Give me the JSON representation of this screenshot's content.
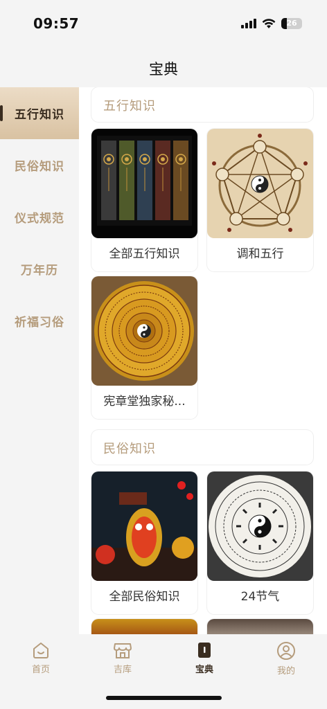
{
  "status_bar": {
    "time": "09:57",
    "battery": "26"
  },
  "page_title": "宝典",
  "sidebar": {
    "items": [
      {
        "label": "五行知识",
        "active": true
      },
      {
        "label": "民俗知识",
        "active": false
      },
      {
        "label": "仪式规范",
        "active": false
      },
      {
        "label": "万年历",
        "active": false
      },
      {
        "label": "祈福习俗",
        "active": false
      }
    ]
  },
  "sections": [
    {
      "title": "五行知识",
      "cards": [
        {
          "label": "全部五行知识",
          "image": "five-element-scrolls"
        },
        {
          "label": "调和五行",
          "image": "five-element-pentagram"
        },
        {
          "label": "宪章堂独家秘...",
          "image": "luopan-compass"
        }
      ]
    },
    {
      "title": "民俗知识",
      "cards": [
        {
          "label": "全部民俗知识",
          "image": "lantern-festival"
        },
        {
          "label": "24节气",
          "image": "solar-terms-wheel"
        }
      ]
    }
  ],
  "tabbar": {
    "items": [
      {
        "label": "首页",
        "icon": "home-icon",
        "active": false
      },
      {
        "label": "吉库",
        "icon": "store-icon",
        "active": false
      },
      {
        "label": "宝典",
        "icon": "book-icon",
        "active": true
      },
      {
        "label": "我的",
        "icon": "profile-icon",
        "active": false
      }
    ]
  },
  "colors": {
    "accent": "#b59c7c",
    "active_text": "#3a2d20",
    "background": "#f4f4f4"
  }
}
